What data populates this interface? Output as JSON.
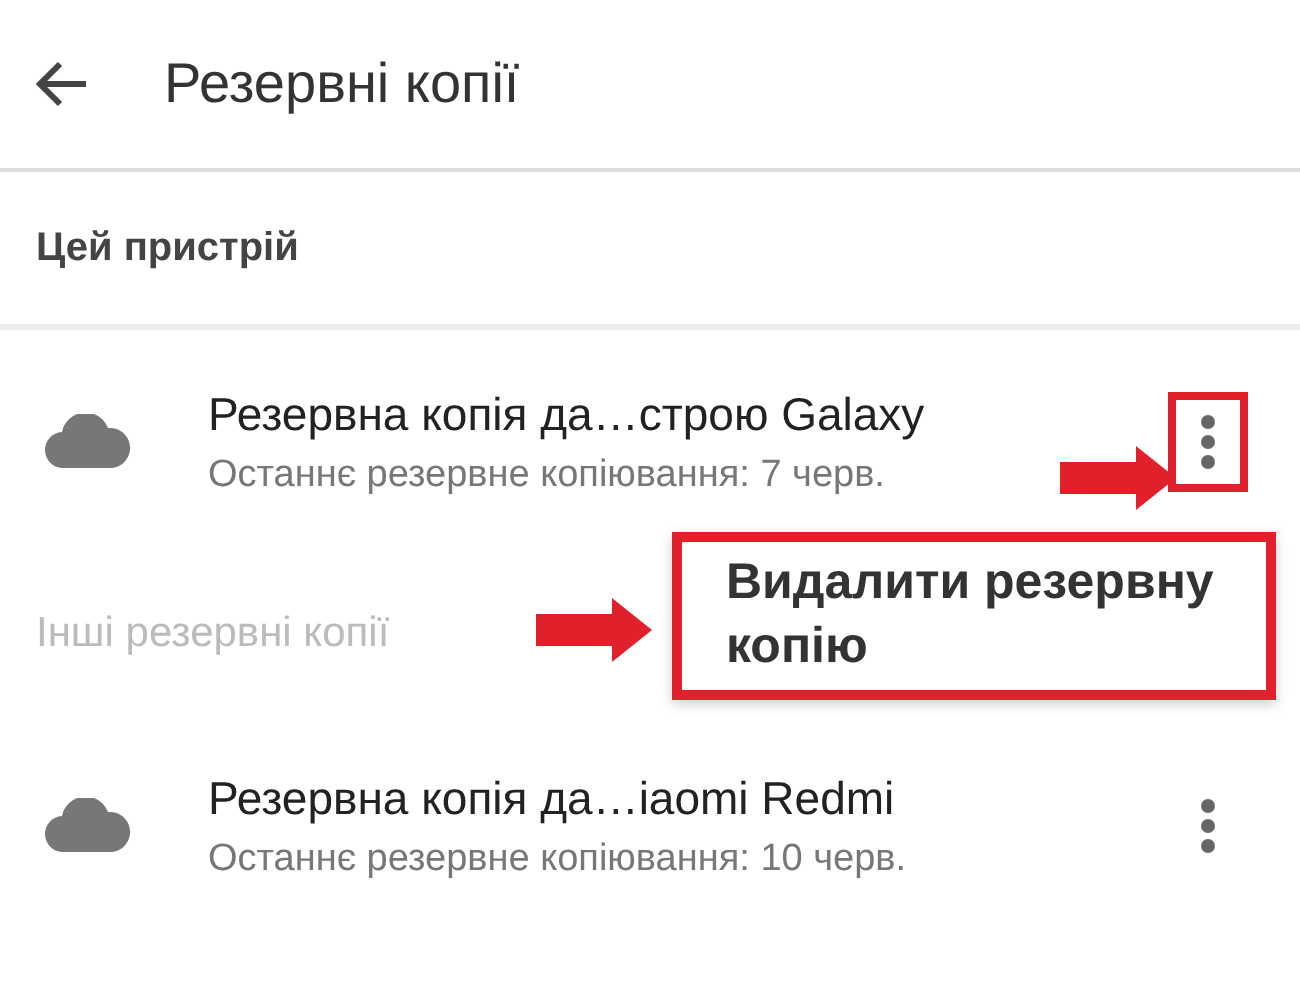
{
  "app_bar": {
    "title": "Резервні копії"
  },
  "sections": [
    {
      "header": "Цей пристрій",
      "items": [
        {
          "title": "Резервна копія да…строю Galaxy",
          "subtitle": "Останнє резервне копіювання: 7 черв.",
          "highlighted": true
        }
      ]
    },
    {
      "header": "Інші резервні копії",
      "items": [
        {
          "title": "Резервна копія да…iaomi Redmi",
          "subtitle": "Останнє резервне копіювання: 10 черв.",
          "highlighted": false
        }
      ]
    }
  ],
  "menu": {
    "items": [
      {
        "label": "Видалити резервну копію",
        "highlighted": true
      }
    ]
  }
}
